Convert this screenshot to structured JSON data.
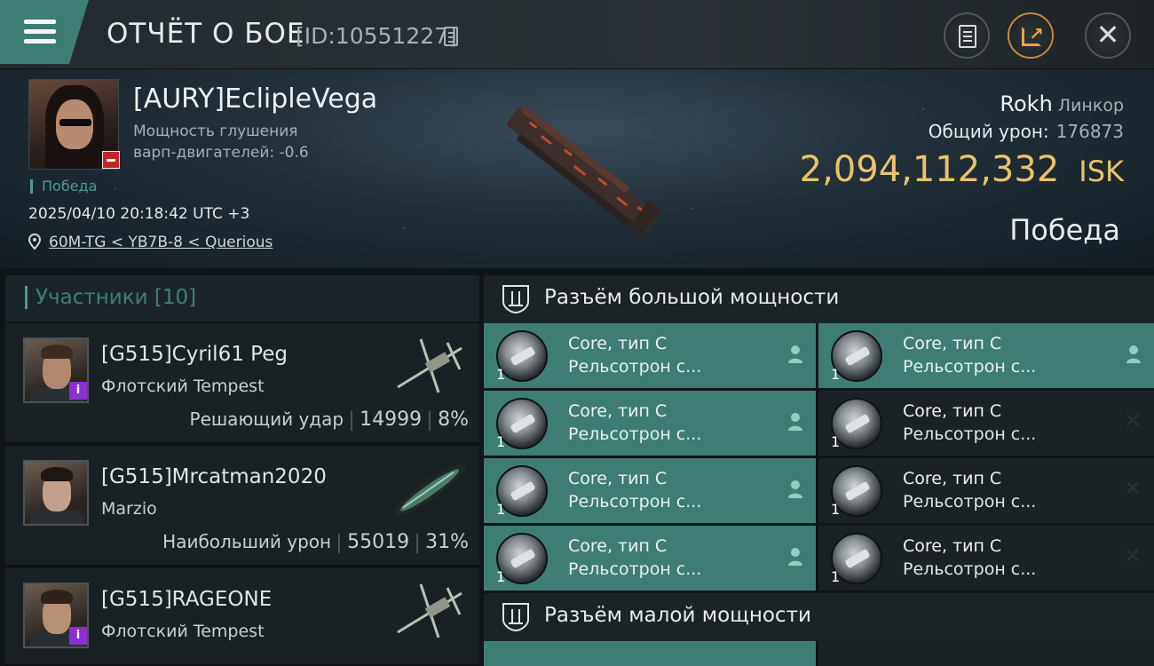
{
  "header": {
    "title": "ОТЧЁТ О БОЕ",
    "battle_id": "[ID:10551227]"
  },
  "victim": {
    "name": "[AURY]EclipleVega",
    "warp_label": "Мощность глушения",
    "warp_value": "варп-двигателей: -0.6",
    "result_small": "Победа",
    "datetime": "2025/04/10 20:18:42 UTC +3",
    "location": "60M-TG < YB7B-8 < Querious",
    "ship_name": "Rokh",
    "ship_class": "Линкор",
    "total_damage_label": "Общий урон:",
    "total_damage": "176873",
    "isk_value": "2,094,112,332",
    "isk_unit": "ISK",
    "result_big": "Победа"
  },
  "participants": {
    "header": "Участники [10]",
    "items": [
      {
        "name": "[G515]Cyril61 Peg",
        "ship": "Флотский Tempest",
        "role": "Решающий удар",
        "damage": "14999",
        "percent": "8%",
        "has_badge": true
      },
      {
        "name": "[G515]Mrcatman2020",
        "ship": "Marzio",
        "role": "Наибольший урон",
        "damage": "55019",
        "percent": "31%",
        "has_badge": false
      },
      {
        "name": "[G515]RAGEONE",
        "ship": "Флотский Tempest",
        "role": "",
        "damage": "",
        "percent": "",
        "has_badge": true
      }
    ]
  },
  "high_slots": {
    "header": "Разъём большой мощности",
    "modules": [
      {
        "name": "Core, тип C",
        "sub": "Рельсотрон с...",
        "qty": "1",
        "state": "teal",
        "marker": "person-icon"
      },
      {
        "name": "Core, тип C",
        "sub": "Рельсотрон с...",
        "qty": "1",
        "state": "teal",
        "marker": "person-icon"
      },
      {
        "name": "Core, тип C",
        "sub": "Рельсотрон с...",
        "qty": "1",
        "state": "teal",
        "marker": "person-icon"
      },
      {
        "name": "Core, тип C",
        "sub": "Рельсотрон с...",
        "qty": "1",
        "state": "dark",
        "marker": "x-icon"
      },
      {
        "name": "Core, тип C",
        "sub": "Рельсотрон с...",
        "qty": "1",
        "state": "teal",
        "marker": "person-icon"
      },
      {
        "name": "Core, тип C",
        "sub": "Рельсотрон с...",
        "qty": "1",
        "state": "dark",
        "marker": "x-icon"
      },
      {
        "name": "Core, тип C",
        "sub": "Рельсотрон с...",
        "qty": "1",
        "state": "teal",
        "marker": "person-icon"
      },
      {
        "name": "Core, тип C",
        "sub": "Рельсотрон с...",
        "qty": "1",
        "state": "dark",
        "marker": "x-icon"
      }
    ]
  },
  "low_slots": {
    "header": "Разъём малой мощности"
  },
  "colors": {
    "accent_teal": "#3e7d74",
    "isk_gold": "#e9c46a",
    "badge_purple": "#8a2fd1",
    "badge_red": "#c62424"
  }
}
